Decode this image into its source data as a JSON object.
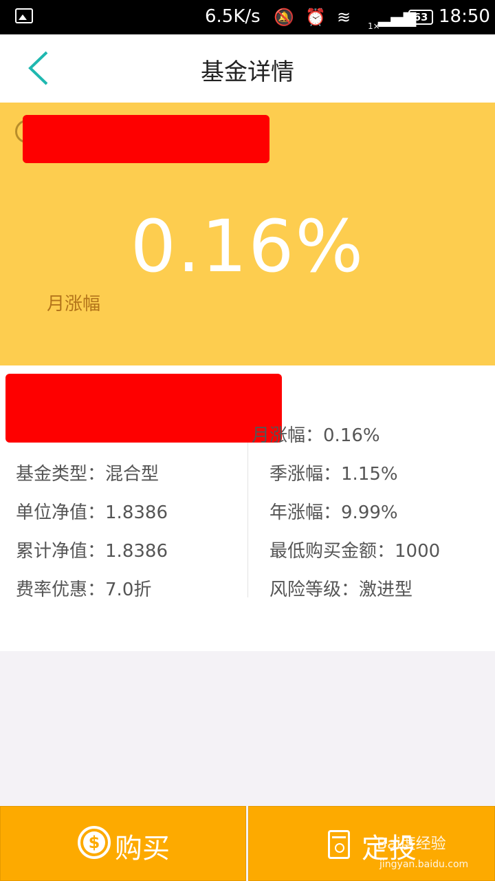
{
  "status_bar": {
    "speed": "6.5K/s",
    "signal_note": "1×",
    "battery": "63",
    "time": "18:50",
    "icons": [
      "image-icon",
      "mute-icon",
      "alarm-icon",
      "wifi-icon",
      "signal-icon",
      "battery-icon"
    ]
  },
  "header": {
    "title": "基金详情"
  },
  "hero": {
    "value": "0.16%",
    "label": "月涨幅"
  },
  "details": {
    "left": [
      {
        "label": "基金类型：",
        "value": "混合型"
      },
      {
        "label": "单位净值：",
        "value": "1.8386"
      },
      {
        "label": "累计净值：",
        "value": "1.8386"
      },
      {
        "label": "费率优惠：",
        "value": "7.0折"
      }
    ],
    "right": [
      {
        "label": "月涨幅：",
        "value": "0.16%"
      },
      {
        "label": "季涨幅：",
        "value": "1.15%"
      },
      {
        "label": "年涨幅：",
        "value": "9.99%"
      },
      {
        "label": "最低购买金额：",
        "value": "1000"
      },
      {
        "label": "风险等级：",
        "value": "激进型"
      }
    ]
  },
  "actions": {
    "buy": "购买",
    "plan": "定投"
  },
  "watermark": {
    "text": "Bai度经验",
    "url": "jingyan.baidu.com"
  },
  "colors": {
    "hero_bg": "#fdcd4f",
    "button_bg": "#fdaa00",
    "accent_back": "#1fb8b0",
    "redaction": "#fe0000"
  }
}
